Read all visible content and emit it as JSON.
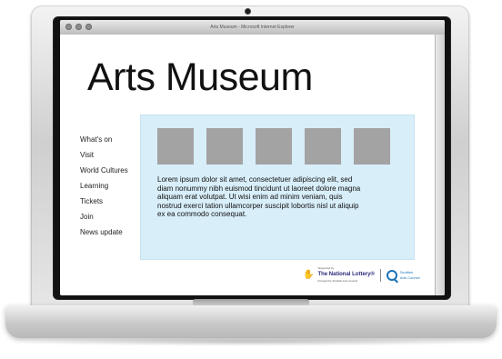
{
  "browser": {
    "window_title": "Arts Museum - Microsoft Internet Explorer"
  },
  "site": {
    "title": "Arts Museum",
    "nav_items": [
      "What's on",
      "Visit",
      "World Cultures",
      "Learning",
      "Tickets",
      "Join",
      "News update"
    ],
    "hero_text": "Lorem ipsum dolor sit amet, consectetuer adipiscing elit, sed diam nonummy nibh euismod tincidunt ut laoreet dolore magna aliquam erat volutpat. Ut wisi enim ad minim veniam, quis nostrud exerci tation ullamcorper suscipit lobortis nisl ut aliquip ex ea commodo consequat.",
    "thumbnails_count": 5
  },
  "footer": {
    "lottery": {
      "line1": "Supported by",
      "title": "The National Lottery®",
      "line2": "through the Scottish Arts Council"
    },
    "arts_council": {
      "line1": "Scottish",
      "line2": "Arts Council"
    }
  },
  "colors": {
    "content_bg": "#d8eef9",
    "thumb_gray": "#a3a3a3",
    "lottery_purple": "#2b2a7a",
    "arts_council_blue": "#1b72b5"
  }
}
